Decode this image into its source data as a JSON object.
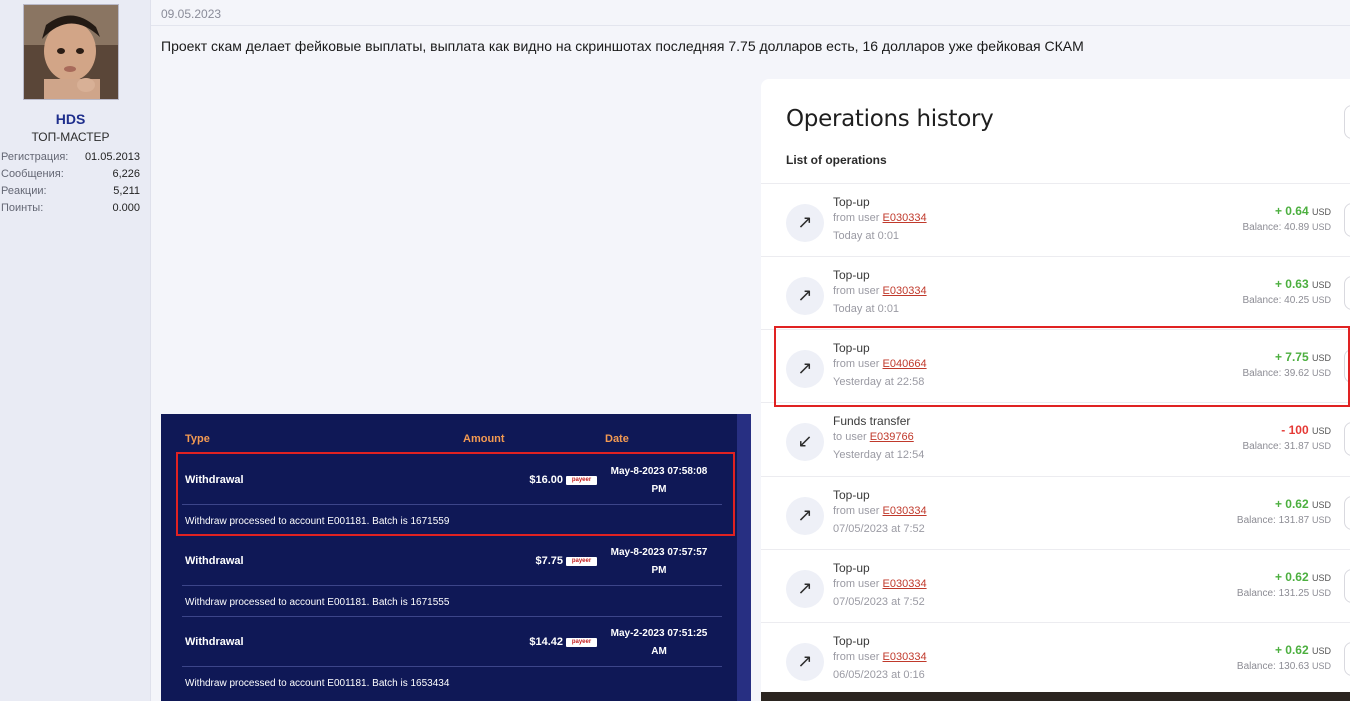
{
  "user": {
    "avatar_label": "avatar",
    "name": "HDS",
    "title": "ТОП-МАСТЕР",
    "stats": [
      {
        "label": "Регистрация:",
        "value": "01.05.2013"
      },
      {
        "label": "Сообщения:",
        "value": "6,226"
      },
      {
        "label": "Реакции:",
        "value": "5,211"
      },
      {
        "label": "Поинты:",
        "value": "0.000"
      }
    ]
  },
  "post": {
    "date": "09.05.2023",
    "text": "Проект скам делает фейковые выплаты, выплата как видно на скриншотах последняя 7.75 долларов есть, 16 долларов уже фейковая СКАМ"
  },
  "withdrawals": {
    "headers": {
      "type": "Type",
      "amount": "Amount",
      "date": "Date"
    },
    "logo_text": "payeer",
    "rows": [
      {
        "type": "Withdrawal",
        "amount": "$16.00",
        "date_line1": "May-8-2023 07:58:08",
        "date_line2": "PM",
        "desc": "Withdraw processed to account E001181. Batch is 1671559"
      },
      {
        "type": "Withdrawal",
        "amount": "$7.75",
        "date_line1": "May-8-2023 07:57:57",
        "date_line2": "PM",
        "desc": "Withdraw processed to account E001181. Batch is 1671555"
      },
      {
        "type": "Withdrawal",
        "amount": "$14.42",
        "date_line1": "May-2-2023 07:51:25",
        "date_line2": "AM",
        "desc": "Withdraw processed to account E001181. Batch is 1653434"
      }
    ]
  },
  "operations": {
    "title": "Operations history",
    "subtitle": "List of operations",
    "currency": "USD",
    "balance_label": "Balance:",
    "items": [
      {
        "icon": "arrow-up-right-icon",
        "glyph": "↗",
        "title": "Top-up",
        "prefix": "from user",
        "account": "E030334",
        "time": "Today at 0:01",
        "amount": "+ 0.64",
        "sign": "positive",
        "balance": "40.89"
      },
      {
        "icon": "arrow-up-right-icon",
        "glyph": "↗",
        "title": "Top-up",
        "prefix": "from user",
        "account": "E030334",
        "time": "Today at 0:01",
        "amount": "+ 0.63",
        "sign": "positive",
        "balance": "40.25"
      },
      {
        "icon": "arrow-up-right-icon",
        "glyph": "↗",
        "title": "Top-up",
        "prefix": "from user",
        "account": "E040664",
        "time": "Yesterday at 22:58",
        "amount": "+ 7.75",
        "sign": "positive",
        "balance": "39.62"
      },
      {
        "icon": "arrow-down-left-icon",
        "glyph": "↙",
        "title": "Funds transfer",
        "prefix": "to user",
        "account": "E039766",
        "time": "Yesterday at 12:54",
        "amount": "- 100",
        "sign": "negative",
        "balance": "31.87"
      },
      {
        "icon": "arrow-up-right-icon",
        "glyph": "↗",
        "title": "Top-up",
        "prefix": "from user",
        "account": "E030334",
        "time": "07/05/2023 at 7:52",
        "amount": "+ 0.62",
        "sign": "positive",
        "balance": "131.87"
      },
      {
        "icon": "arrow-up-right-icon",
        "glyph": "↗",
        "title": "Top-up",
        "prefix": "from user",
        "account": "E030334",
        "time": "07/05/2023 at 7:52",
        "amount": "+ 0.62",
        "sign": "positive",
        "balance": "131.25"
      },
      {
        "icon": "arrow-up-right-icon",
        "glyph": "↗",
        "title": "Top-up",
        "prefix": "from user",
        "account": "E030334",
        "time": "06/05/2023 at 0:16",
        "amount": "+ 0.62",
        "sign": "positive",
        "balance": "130.63"
      }
    ]
  },
  "colors": {
    "accent_blue": "#1e2e8c",
    "highlight_red": "#e02222",
    "positive": "#4caf3f",
    "negative": "#e53935",
    "table_bg": "#0f1856",
    "table_header": "#f39a52"
  }
}
